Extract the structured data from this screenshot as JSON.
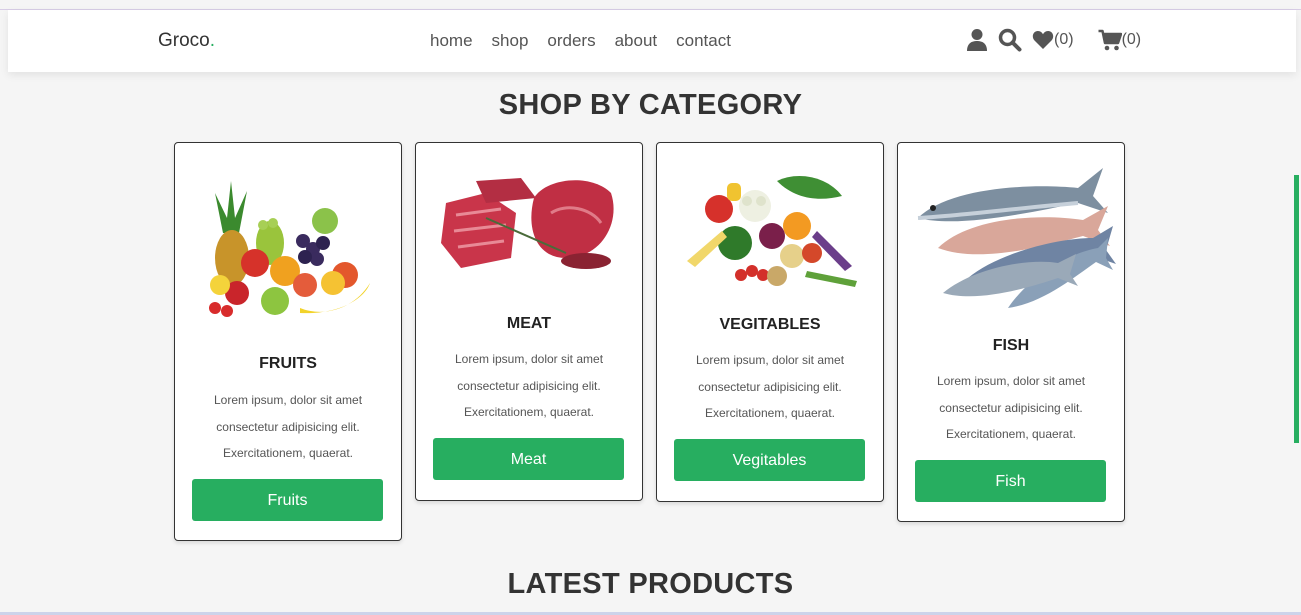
{
  "header": {
    "logo_text": "Groco",
    "logo_dot": ".",
    "nav": [
      "home",
      "shop",
      "orders",
      "about",
      "contact"
    ],
    "wishlist_count": "(0)",
    "cart_count": "(0)",
    "icons": [
      "user-icon",
      "search-icon",
      "heart-icon",
      "cart-icon"
    ]
  },
  "category_section": {
    "title": "SHOP BY CATEGORY",
    "cards": [
      {
        "title": "FRUITS",
        "description": "Lorem ipsum, dolor sit amet consectetur adipisicing elit. Exercitationem, quaerat.",
        "button": "Fruits"
      },
      {
        "title": "MEAT",
        "description": "Lorem ipsum, dolor sit amet consectetur adipisicing elit. Exercitationem, quaerat.",
        "button": "Meat"
      },
      {
        "title": "VEGITABLES",
        "description": "Lorem ipsum, dolor sit amet consectetur adipisicing elit. Exercitationem, quaerat.",
        "button": "Vegitables"
      },
      {
        "title": "FISH",
        "description": "Lorem ipsum, dolor sit amet consectetur adipisicing elit. Exercitationem, quaerat.",
        "button": "Fish"
      }
    ]
  },
  "products_section": {
    "title": "LATEST PRODUCTS"
  },
  "colors": {
    "accent": "#27ae60",
    "background": "#f5f5f5",
    "text": "#333333"
  }
}
